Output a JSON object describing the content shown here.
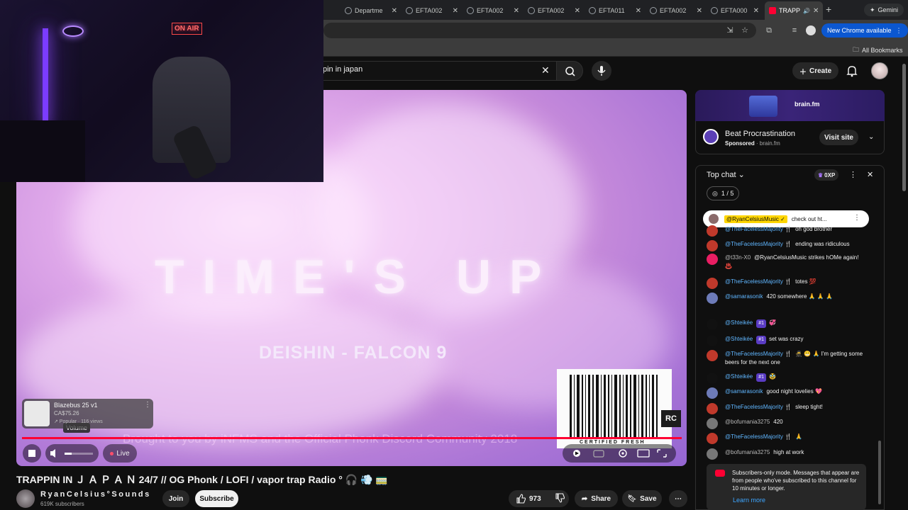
{
  "browser": {
    "tabs": [
      {
        "label": "Departme",
        "active": false
      },
      {
        "label": "EFTA002",
        "active": false
      },
      {
        "label": "EFTA002",
        "active": false
      },
      {
        "label": "EFTA002",
        "active": false
      },
      {
        "label": "EFTA011",
        "active": false
      },
      {
        "label": "EFTA002",
        "active": false
      },
      {
        "label": "EFTA000",
        "active": false
      },
      {
        "label": "TRAPP",
        "active": true
      }
    ],
    "gemini_label": "Gemini",
    "new_chrome_label": "New Chrome available",
    "all_bookmarks_label": "All Bookmarks"
  },
  "youtube": {
    "search_value": "pin in japan",
    "create_label": "Create"
  },
  "video": {
    "overlay_title": "TIME'S UP",
    "overlay_track": "DEISHIN - FALCON 9",
    "overlay_credit": "Brought to you by iNFMS and the Official Phonk Discord Community 2018",
    "barcode_caption": "CERTIFIED FRESH",
    "rc_logo": "RC",
    "volume_tooltip": "Volume",
    "volume_level": 0.25,
    "live_label": "Live",
    "product": {
      "name": "Blazebus 25 v1",
      "price": "CA$75.26",
      "meta": "↗ Popular · 116 views"
    }
  },
  "webcam": {
    "on_air_sign": "ON AIR"
  },
  "meta": {
    "title": "TRAPPIN IN Ｊ Ａ Ｐ Ａ Ｎ 24/7 // OG Phonk / LOFI / vapor trap Radio ° 🎧 💨 🚃",
    "channel_name": "RyanCelsius°Sounds",
    "subscribers": "619K subscribers",
    "join_label": "Join",
    "subscribe_label": "Subscribe",
    "likes": "973",
    "share_label": "Share",
    "save_label": "Save"
  },
  "ad": {
    "banner_brand": "brain.fm",
    "title": "Beat Procrastination",
    "sponsored": "Sponsored",
    "domain": "brain.fm",
    "visit_label": "Visit site"
  },
  "chat": {
    "header": "Top chat",
    "xp": "0XP",
    "poll": "1 / 5",
    "pinned_author": "@RyanCelsiusMusic ✓",
    "pinned_text": "check out ht...",
    "messages": [
      {
        "author": "@TheFacelessMajority 🍴",
        "text": "oh god brother",
        "color": "#c0392b"
      },
      {
        "author": "@TheFacelessMajority 🍴",
        "text": "ending was ridiculous",
        "color": "#c0392b"
      },
      {
        "author": "@t33n-X0",
        "text": "@RyanCelsiusMusic strikes hOMe again! ♨️",
        "color": "#e91e63",
        "grey": true
      },
      {
        "author": "@TheFacelessMajority 🍴",
        "text": "totes 💯",
        "color": "#c0392b"
      },
      {
        "author": "@samarasonik",
        "text": "420 somewhere 🙏 🙏 🙏",
        "color": "#6d7bb8"
      },
      {
        "author": "@Shteikée",
        "badge": "#1",
        "text": "💞",
        "color": "#111"
      },
      {
        "author": "@Shteikée",
        "badge": "#1",
        "text": "set was crazy",
        "color": "#111"
      },
      {
        "author": "@TheFacelessMajority 🍴",
        "text": "🥷 😬 🙏 I'm getting some beers for the next one",
        "color": "#c0392b"
      },
      {
        "author": "@Shteikée",
        "badge": "#1",
        "text": "🥸",
        "color": "#111"
      },
      {
        "author": "@samarasonik",
        "text": "good night lovelies 💖",
        "color": "#6d7bb8"
      },
      {
        "author": "@TheFacelessMajority 🍴",
        "text": "sleep tight!",
        "color": "#c0392b"
      },
      {
        "author": "@bofumania3275",
        "text": "420",
        "color": "#777",
        "grey": true
      },
      {
        "author": "@TheFacelessMajority 🍴",
        "text": "🙏",
        "color": "#c0392b"
      },
      {
        "author": "@bofumania3275",
        "text": "high at work",
        "color": "#777",
        "grey": true
      }
    ],
    "notice_text": "Subscribers-only mode. Messages that appear are from people who've subscribed to this channel for 10 minutes or longer.",
    "learn_more": "Learn more"
  }
}
